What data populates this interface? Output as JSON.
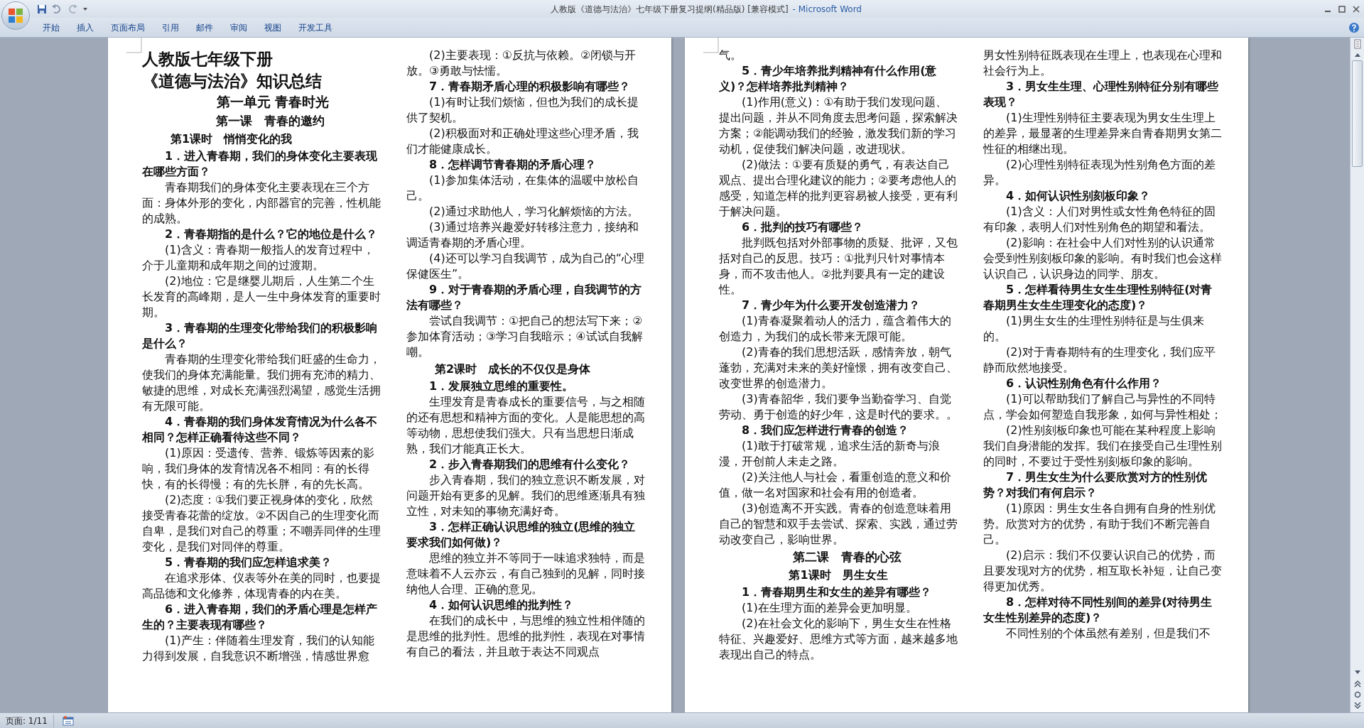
{
  "window": {
    "document_title": "人教版《道德与法治》七年级下册复习提纲(精品版) [兼容模式]",
    "app_name": "- Microsoft Word"
  },
  "ribbon_tabs": [
    {
      "label": "开始",
      "selected": false
    },
    {
      "label": "插入",
      "selected": false
    },
    {
      "label": "页面布局",
      "selected": false
    },
    {
      "label": "引用",
      "selected": false
    },
    {
      "label": "邮件",
      "selected": false
    },
    {
      "label": "审阅",
      "selected": false
    },
    {
      "label": "视图",
      "selected": false
    },
    {
      "label": "开发工具",
      "selected": false
    }
  ],
  "pages": [
    {
      "columns": [
        [
          {
            "kind": "doc_title",
            "text": "人教版七年级下册"
          },
          {
            "kind": "doc_subtitle",
            "text": "《道德与法治》知识总结"
          },
          {
            "kind": "unit",
            "text": "第一单元 青春时光"
          },
          {
            "kind": "lesson",
            "text": "第一课　青春的邀约"
          },
          {
            "kind": "period",
            "text": "第1课时　悄悄变化的我"
          },
          {
            "kind": "question",
            "text": "1．进入青春期，我们的身体变化主要表现在哪些方面？"
          },
          {
            "kind": "body",
            "text": "青春期我们的身体变化主要表现在三个方面：身体外形的变化，内部器官的完善，性机能的成熟。"
          },
          {
            "kind": "question",
            "text": "2．青春期指的是什么？它的地位是什么？"
          },
          {
            "kind": "body",
            "text": "(1)含义：青春期一般指人的发育过程中，介于儿童期和成年期之间的过渡期。"
          },
          {
            "kind": "body",
            "text": "(2)地位：它是继婴儿期后，人生第二个生长发育的高峰期，是人一生中身体发育的重要时期。"
          },
          {
            "kind": "question",
            "text": "3．青春期的生理变化带给我们的积极影响是什么？"
          },
          {
            "kind": "body",
            "text": "青春期的生理变化带给我们旺盛的生命力，使我们的身体充满能量。我们拥有充沛的精力、敏捷的思维，对成长充满强烈渴望，感觉生活拥有无限可能。"
          },
          {
            "kind": "question",
            "text": "4．青春期的我们身体发育情况为什么各不相同？怎样正确看待这些不同？"
          },
          {
            "kind": "body",
            "text": "(1)原因：受遗传、营养、锻炼等因素的影响，我们身体的发育情况各不相同：有的长得快，有的长得慢；有的先长胖，有的先长高。"
          },
          {
            "kind": "body",
            "text": "(2)态度：①我们要正视身体的变化，欣然接受青春花蕾的绽放。②不因自己的生理变化而自卑，是我们对自己的尊重；不嘲弄同伴的生理变化，是我们对同伴的尊重。"
          },
          {
            "kind": "question",
            "text": "5．青春期的我们应怎样追求美？"
          },
          {
            "kind": "body",
            "text": "在追求形体、仪表等外在美的同时，也要提高品德和文化修养，体现青春的内在美。"
          },
          {
            "kind": "question",
            "text": "6．进入青春期，我们的矛盾心理是怎样产生的？主要表现有哪些？"
          },
          {
            "kind": "body",
            "text": "(1)产生：伴随着生理发育，我们的认知能力得到发展，自我意识不断增强，情感世界愈"
          }
        ],
        [
          {
            "kind": "body",
            "text": "(2)主要表现：①反抗与依赖。②闭锁与开放。③勇敢与怯懦。"
          },
          {
            "kind": "question",
            "text": "7．青春期矛盾心理的积极影响有哪些？"
          },
          {
            "kind": "body",
            "text": "(1)有时让我们烦恼，但也为我们的成长提供了契机。"
          },
          {
            "kind": "body",
            "text": "(2)积极面对和正确处理这些心理矛盾，我们才能健康成长。"
          },
          {
            "kind": "question",
            "text": "8．怎样调节青春期的矛盾心理？"
          },
          {
            "kind": "body",
            "text": "(1)参加集体活动，在集体的温暖中放松自己。"
          },
          {
            "kind": "body",
            "text": "(2)通过求助他人，学习化解烦恼的方法。"
          },
          {
            "kind": "body",
            "text": "(3)通过培养兴趣爱好转移注意力，接纳和调适青春期的矛盾心理。"
          },
          {
            "kind": "body",
            "text": "(4)还可以学习自我调节，成为自己的“心理保健医生”。"
          },
          {
            "kind": "question",
            "text": "9．对于青春期的矛盾心理，自我调节的方法有哪些？"
          },
          {
            "kind": "body",
            "text": "尝试自我调节：①把自己的想法写下来；②参加体育活动；③学习自我暗示；④试试自我解嘲。"
          },
          {
            "kind": "period",
            "text": "第2课时　成长的不仅仅是身体"
          },
          {
            "kind": "question",
            "text": "1．发展独立思维的重要性。"
          },
          {
            "kind": "body",
            "text": "生理发育是青春成长的重要信号，与之相随的还有思想和精神方面的变化。人是能思想的高等动物，思想使我们强大。只有当思想日渐成熟，我们才能真正长大。"
          },
          {
            "kind": "question",
            "text": "2．步入青春期我们的思维有什么变化？"
          },
          {
            "kind": "body",
            "text": "步入青春期，我们的独立意识不断发展，对问题开始有更多的见解。我们的思维逐渐具有独立性，对未知的事物充满好奇。"
          },
          {
            "kind": "question",
            "text": "3．怎样正确认识思维的独立(思维的独立要求我们如何做)？"
          },
          {
            "kind": "body",
            "text": "思维的独立并不等同于一味追求独特，而是意味着不人云亦云，有自己独到的见解，同时接纳他人合理、正确的意见。"
          },
          {
            "kind": "question",
            "text": "4．如何认识思维的批判性？"
          },
          {
            "kind": "body",
            "text": "在我们的成长中，与思维的独立性相伴随的是思维的批判性。思维的批判性，表现在对事情有自己的看法，并且敢于表达不同观点"
          }
        ]
      ]
    },
    {
      "columns": [
        [
          {
            "kind": "continued",
            "text": "气。"
          },
          {
            "kind": "question",
            "text": "5．青少年培养批判精神有什么作用(意义)？怎样培养批判精神？"
          },
          {
            "kind": "body",
            "text": "(1)作用(意义)：①有助于我们发现问题、提出问题，并从不同角度去思考问题，探索解决方案；②能调动我们的经验，激发我们新的学习动机，促使我们解决问题，改进现状。"
          },
          {
            "kind": "body",
            "text": "(2)做法：①要有质疑的勇气，有表达自己观点、提出合理化建议的能力；②要考虑他人的感受，知道怎样的批判更容易被人接受，更有利于解决问题。"
          },
          {
            "kind": "question",
            "text": "6．批判的技巧有哪些？"
          },
          {
            "kind": "body",
            "text": "批判既包括对外部事物的质疑、批评，又包括对自己的反思。技巧：①批判只针对事情本身，而不攻击他人。②批判要具有一定的建设性。"
          },
          {
            "kind": "question",
            "text": "7．青少年为什么要开发创造潜力？"
          },
          {
            "kind": "body",
            "text": "(1)青春凝聚着动人的活力，蕴含着伟大的创造力，为我们的成长带来无限可能。"
          },
          {
            "kind": "body",
            "text": "(2)青春的我们思想活跃，感情奔放，朝气蓬勃，充满对未来的美好憧憬，拥有改变自己、改变世界的创造潜力。"
          },
          {
            "kind": "body",
            "text": "(3)青春韶华，我们要争当勤奋学习、自觉劳动、勇于创造的好少年，这是时代的要求。。"
          },
          {
            "kind": "question",
            "text": "8．我们应怎样进行青春的创造？"
          },
          {
            "kind": "body",
            "text": "(1)敢于打破常规，追求生活的新奇与浪漫，开创前人未走之路。"
          },
          {
            "kind": "body",
            "text": "(2)关注他人与社会，看重创造的意义和价值，做一名对国家和社会有用的创造者。"
          },
          {
            "kind": "body",
            "text": "(3)创造离不开实践。青春的创造意味着用自己的智慧和双手去尝试、探索、实践，通过劳动改变自己，影响世界。"
          },
          {
            "kind": "lesson",
            "text": "第二课　青春的心弦"
          },
          {
            "kind": "period_centered",
            "text": "第1课时　男生女生"
          },
          {
            "kind": "question",
            "text": "1．青春期男生和女生的差异有哪些？"
          },
          {
            "kind": "body",
            "text": "(1)在生理方面的差异会更加明显。"
          },
          {
            "kind": "body",
            "text": "(2)在社会文化的影响下，男生女生在性格特征、兴趣爱好、思维方式等方面，越来越多地表现出自己的特点。"
          }
        ],
        [
          {
            "kind": "continued",
            "text": "男女性别特征既表现在生理上，也表现在心理和社会行为上。"
          },
          {
            "kind": "question",
            "text": "3．男女生生理、心理性别特征分别有哪些表现？"
          },
          {
            "kind": "body",
            "text": "(1)生理性别特征主要表现为男女生生理上的差异，最显著的生理差异来自青春期男女第二性征的相继出现。"
          },
          {
            "kind": "body",
            "text": "(2)心理性别特征表现为性别角色方面的差异。"
          },
          {
            "kind": "question",
            "text": "4．如何认识性别刻板印象？"
          },
          {
            "kind": "body",
            "text": "(1)含义：人们对男性或女性角色特征的固有印象，表明人们对性别角色的期望和看法。"
          },
          {
            "kind": "body",
            "text": "(2)影响：在社会中人们对性别的认识通常会受到性别刻板印象的影响。有时我们也会这样认识自己，认识身边的同学、朋友。"
          },
          {
            "kind": "question",
            "text": "5．怎样看待男生女生生理性别特征(对青春期男生女生生理变化的态度)？"
          },
          {
            "kind": "body",
            "text": "(1)男生女生的生理性别特征是与生俱来的。"
          },
          {
            "kind": "body",
            "text": "(2)对于青春期特有的生理变化，我们应平静而欣然地接受。"
          },
          {
            "kind": "question",
            "text": "6．认识性别角色有什么作用？"
          },
          {
            "kind": "body",
            "text": "(1)可以帮助我们了解自己与异性的不同特点，学会如何塑造自我形象，如何与异性相处；"
          },
          {
            "kind": "body",
            "text": "(2)性别刻板印象也可能在某种程度上影响我们自身潜能的发挥。我们在接受自己生理性别的同时，不要过于受性别刻板印象的影响。"
          },
          {
            "kind": "question",
            "text": "7．男生女生为什么要欣赏对方的性别优势？对我们有何启示？"
          },
          {
            "kind": "body",
            "text": "(1)原因：男生女生各自拥有自身的性别优势。欣赏对方的优势，有助于我们不断完善自己。"
          },
          {
            "kind": "body",
            "text": "(2)启示：我们不仅要认识自己的优势，而且要发现对方的优势，相互取长补短，让自己变得更加优秀。"
          },
          {
            "kind": "question",
            "text": "8．怎样对待不同性别间的差异(对待男生女生性别差异的态度)？"
          },
          {
            "kind": "body",
            "text": "不同性别的个体虽然有差别，但是我们不"
          }
        ]
      ]
    }
  ],
  "status_bar": {
    "page": "页面: 1/11"
  }
}
